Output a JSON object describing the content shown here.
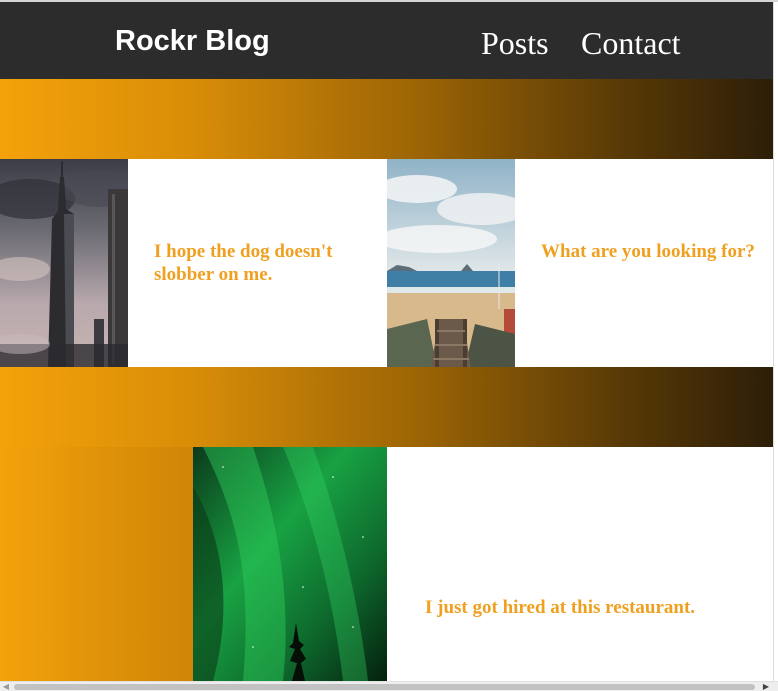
{
  "header": {
    "brand": "Rockr Blog",
    "nav": [
      {
        "label": "Posts"
      },
      {
        "label": "Contact"
      }
    ]
  },
  "posts": [
    {
      "title": "I hope the dog doesn't slobber on me.",
      "image_icon": "skyscraper-photo"
    },
    {
      "title": "What are you looking for?",
      "image_icon": "beach-photo"
    },
    {
      "title": "I just got hired at this restaurant.",
      "image_icon": "aurora-photo"
    }
  ],
  "colors": {
    "header_bg": "#2c2c2c",
    "accent": "#f0a020",
    "gradient_start": "#f4a20a",
    "gradient_end": "#2c1e08"
  },
  "scrollbar": {
    "left_arrow_icon": "arrow-left-icon",
    "right_arrow_icon": "arrow-right-icon"
  }
}
